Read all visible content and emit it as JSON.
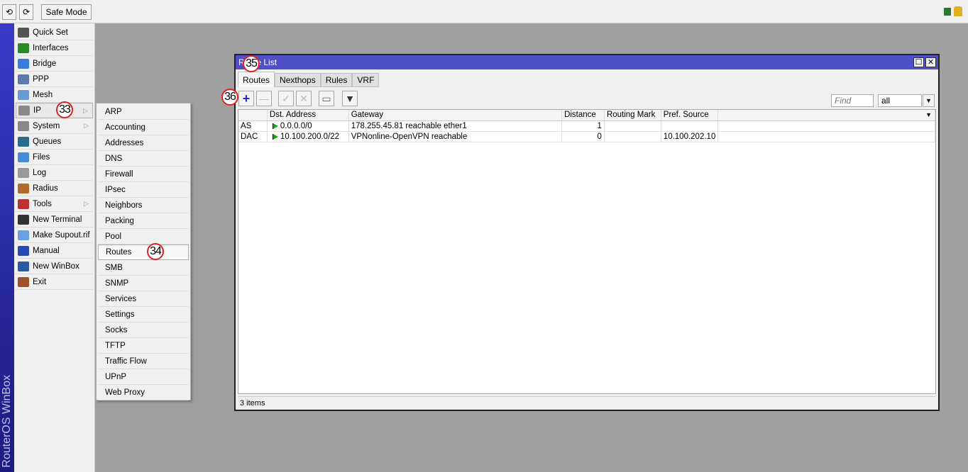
{
  "toolbar": {
    "undo_icon": "undo-icon",
    "redo_icon": "redo-icon",
    "safe_mode": "Safe Mode"
  },
  "brand": "RouterOS WinBox",
  "sidebar": {
    "items": [
      {
        "label": "Quick Set",
        "icon": "wand-icon",
        "color": "#555"
      },
      {
        "label": "Interfaces",
        "icon": "network-card-icon",
        "color": "#2a8a2a"
      },
      {
        "label": "Bridge",
        "icon": "bridge-icon",
        "color": "#3a7ad8"
      },
      {
        "label": "PPP",
        "icon": "ppp-icon",
        "color": "#5a7ab0"
      },
      {
        "label": "Mesh",
        "icon": "mesh-icon",
        "color": "#6a9ad0"
      },
      {
        "label": "IP",
        "icon": "ip-icon",
        "color": "#888",
        "submenu": true,
        "selected": true
      },
      {
        "label": "System",
        "icon": "gear-icon",
        "color": "#888",
        "submenu": true
      },
      {
        "label": "Queues",
        "icon": "queues-icon",
        "color": "#2a6a8a"
      },
      {
        "label": "Files",
        "icon": "folder-icon",
        "color": "#4a8ad8"
      },
      {
        "label": "Log",
        "icon": "log-icon",
        "color": "#999"
      },
      {
        "label": "Radius",
        "icon": "users-icon",
        "color": "#b06a2a"
      },
      {
        "label": "Tools",
        "icon": "tools-icon",
        "color": "#c03030",
        "submenu": true
      },
      {
        "label": "New Terminal",
        "icon": "terminal-icon",
        "color": "#333"
      },
      {
        "label": "Make Supout.rif",
        "icon": "file-icon",
        "color": "#6aa0e0"
      },
      {
        "label": "Manual",
        "icon": "help-icon",
        "color": "#2a4ab0"
      },
      {
        "label": "New WinBox",
        "icon": "winbox-icon",
        "color": "#2a5aa0"
      },
      {
        "label": "Exit",
        "icon": "door-icon",
        "color": "#a0522d"
      }
    ]
  },
  "ip_submenu": {
    "items": [
      "ARP",
      "Accounting",
      "Addresses",
      "DNS",
      "Firewall",
      "IPsec",
      "Neighbors",
      "Packing",
      "Pool",
      "Routes",
      "SMB",
      "SNMP",
      "Services",
      "Settings",
      "Socks",
      "TFTP",
      "Traffic Flow",
      "UPnP",
      "Web Proxy"
    ],
    "selected": "Routes"
  },
  "annotations": {
    "ip": "33",
    "routes": "34",
    "title": "35",
    "add": "36"
  },
  "window": {
    "title": "Route List",
    "tabs": [
      "Routes",
      "Nexthops",
      "Rules",
      "VRF"
    ],
    "active_tab": "Routes",
    "find_placeholder": "Find",
    "filter_value": "all",
    "columns": [
      "",
      "Dst. Address",
      "Gateway",
      "Distance",
      "Routing Mark",
      "Pref. Source"
    ],
    "rows": [
      {
        "flags": "AS",
        "dst": "0.0.0.0/0",
        "gateway": "178.255.45.81 reachable ether1",
        "distance": "1",
        "mark": "",
        "pref_src": ""
      },
      {
        "flags": "DAC",
        "dst": "10.100.200.0/22",
        "gateway": "VPNonline-OpenVPN reachable",
        "distance": "0",
        "mark": "",
        "pref_src": "10.100.202.10"
      }
    ],
    "status": "3 items"
  },
  "colors": {
    "title_bar": "#4f50c8",
    "brand_bar": "#2a2aa8",
    "annotation": "#e02020"
  }
}
